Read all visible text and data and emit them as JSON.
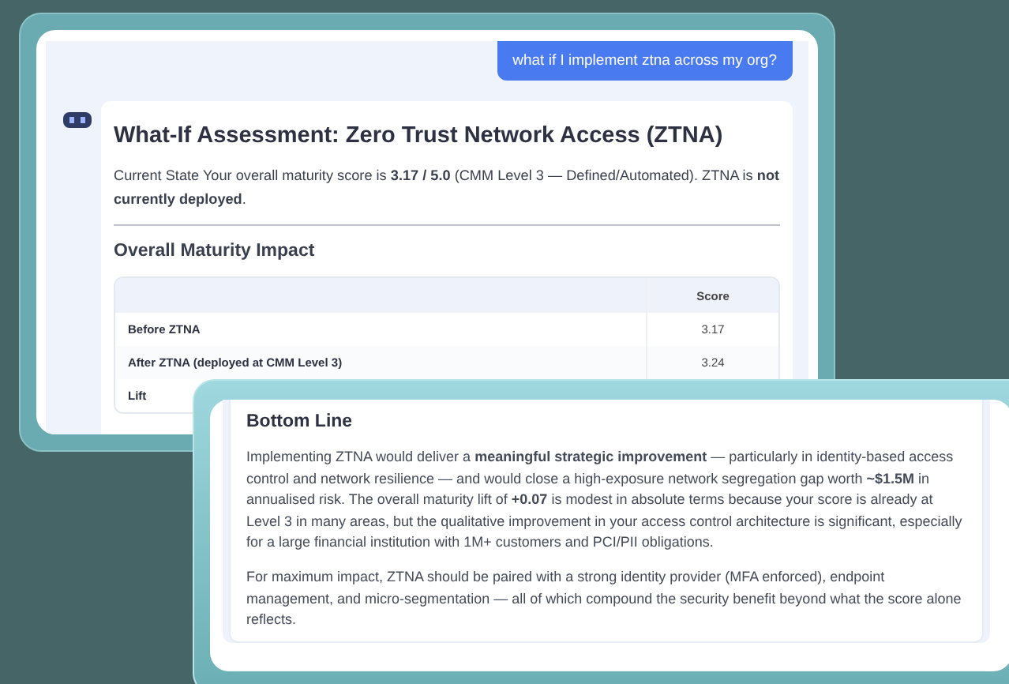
{
  "chat": {
    "user_message": "what if I implement ztna across my org?",
    "answer": {
      "title": "What-If Assessment: Zero Trust Network Access (ZTNA)",
      "intro": "Current State Your overall maturity score is **3.17 / 5.0** (CMM Level 3 — Defined/Automated). ZTNA is **not currently deployed**.",
      "section_title": "Overall Maturity Impact",
      "table": {
        "columns": [
          "Score"
        ],
        "rows": [
          {
            "label": "Before ZTNA",
            "score": "3.17"
          },
          {
            "label": "After ZTNA (deployed at CMM Level 3)",
            "score": "3.24"
          },
          {
            "label": "Lift"
          }
        ]
      }
    }
  },
  "bottom_line": {
    "title": "Bottom Line",
    "paragraphs": [
      "Implementing ZTNA would deliver a **meaningful strategic improvement** — particularly in identity-based access control and network resilience — and would close a high-exposure network segregation gap worth **~$1.5M** in annualised risk. The overall maturity lift of **+0.07** is modest in absolute terms because your score is already at Level 3 in many areas, but the qualitative improvement in your access control architecture is significant, especially for a large financial institution with 1M+ customers and PCI/PII obligations.",
      "For maximum impact, ZTNA should be paired with a strong identity provider (MFA enforced), endpoint management, and micro-segmentation — all of which compound the security benefit beyond what the score alone reflects."
    ]
  }
}
